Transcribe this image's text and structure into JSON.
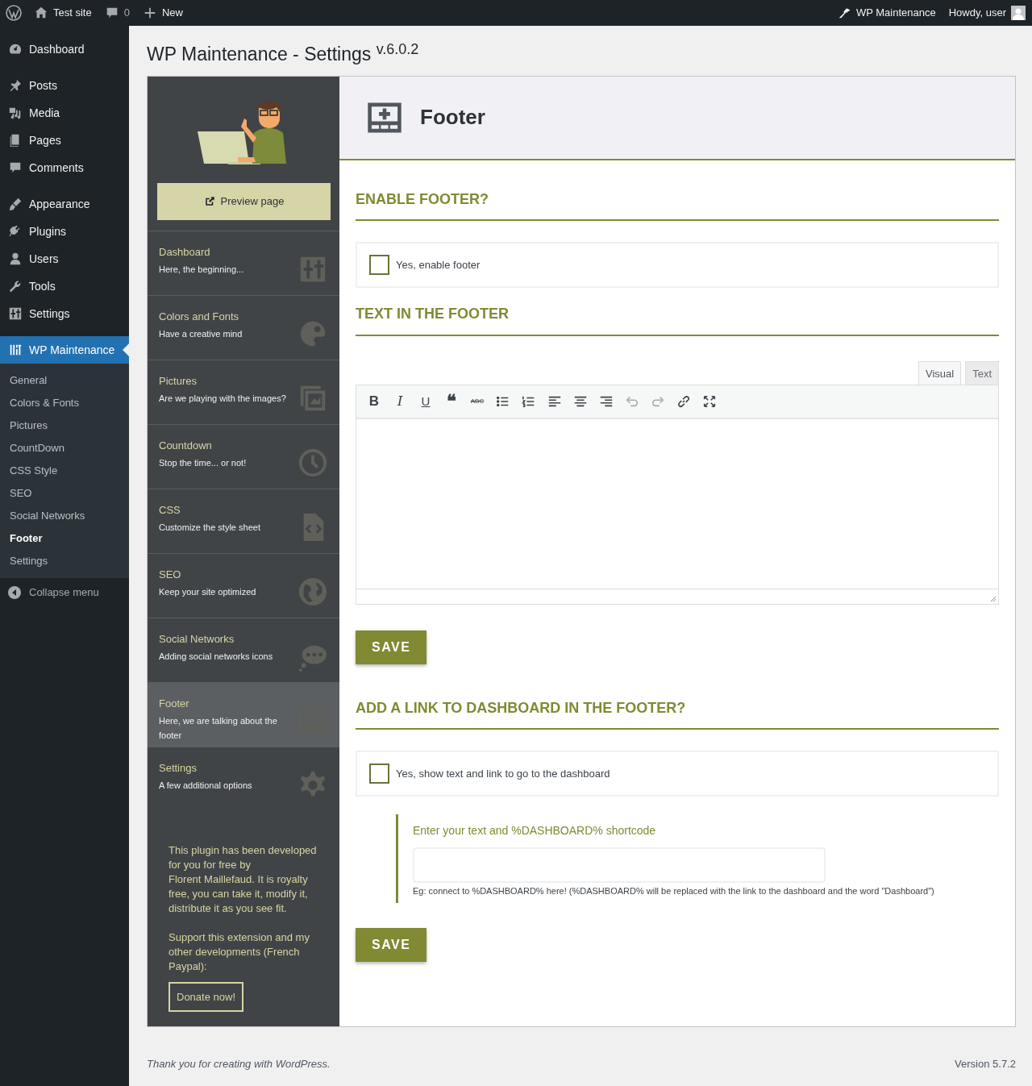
{
  "admin_bar": {
    "site": "Test site",
    "comments": "0",
    "new": "New",
    "plugin": "WP Maintenance",
    "greeting": "Howdy, user"
  },
  "admin_menu": {
    "groups": [
      [
        {
          "label": "Dashboard",
          "selected": false
        }
      ],
      [
        {
          "label": "Posts",
          "selected": false
        },
        {
          "label": "Media",
          "selected": false
        },
        {
          "label": "Pages",
          "selected": false
        },
        {
          "label": "Comments",
          "selected": false
        }
      ],
      [
        {
          "label": "Appearance",
          "selected": false
        },
        {
          "label": "Plugins",
          "selected": false
        },
        {
          "label": "Users",
          "selected": false
        },
        {
          "label": "Tools",
          "selected": false
        },
        {
          "label": "Settings",
          "selected": false
        }
      ],
      [
        {
          "label": "WP Maintenance",
          "selected": true
        }
      ]
    ],
    "submenu": [
      {
        "label": "General",
        "selected": false
      },
      {
        "label": "Colors & Fonts",
        "selected": false
      },
      {
        "label": "Pictures",
        "selected": false
      },
      {
        "label": "CountDown",
        "selected": false
      },
      {
        "label": "CSS Style",
        "selected": false
      },
      {
        "label": "SEO",
        "selected": false
      },
      {
        "label": "Social Networks",
        "selected": false
      },
      {
        "label": "Footer",
        "selected": true
      },
      {
        "label": "Settings",
        "selected": false
      }
    ],
    "collapse": "Collapse menu"
  },
  "page": {
    "title": "WP Maintenance - Settings",
    "version": "v.6.0.2"
  },
  "plugin_nav": {
    "preview": "Preview page",
    "items": [
      {
        "title": "Dashboard",
        "subtitle": "Here, the beginning...",
        "selected": false
      },
      {
        "title": "Colors and Fonts",
        "subtitle": "Have a creative mind",
        "selected": false
      },
      {
        "title": "Pictures",
        "subtitle": "Are we playing with the images?",
        "selected": false
      },
      {
        "title": "Countdown",
        "subtitle": "Stop the time... or not!",
        "selected": false
      },
      {
        "title": "CSS",
        "subtitle": "Customize the style sheet",
        "selected": false
      },
      {
        "title": "SEO",
        "subtitle": "Keep your site optimized",
        "selected": false
      },
      {
        "title": "Social Networks",
        "subtitle": "Adding social networks icons",
        "selected": false
      },
      {
        "title": "Footer",
        "subtitle": "Here, we are talking about the footer",
        "selected": true
      },
      {
        "title": "Settings",
        "subtitle": "A few additional options",
        "selected": false
      }
    ],
    "credit": {
      "before": "This plugin has been developed for you for free by",
      "link": "Florent Maillefaud",
      "after": ". It is royalty free, you can take it, modify it, distribute it as you see fit."
    },
    "support": "Support this extension and my other developments (French Paypal):",
    "donate": "Donate now!"
  },
  "panel": {
    "title": "Footer",
    "enable": {
      "heading": "ENABLE FOOTER?",
      "checkbox": {
        "label": "Yes, enable footer",
        "checked": false
      }
    },
    "text": {
      "heading": "TEXT IN THE FOOTER",
      "tabs": [
        {
          "label": "Visual",
          "selected": true
        },
        {
          "label": "Text",
          "selected": false
        }
      ],
      "toolbar": [
        {
          "kind": "bold",
          "glyph": "B"
        },
        {
          "kind": "italic",
          "glyph": "I"
        },
        {
          "kind": "underline",
          "glyph": "U"
        },
        {
          "kind": "quote",
          "glyph": "❝"
        },
        {
          "kind": "strike",
          "glyph": "ABC"
        },
        {
          "kind": "bullets"
        },
        {
          "kind": "numbers"
        },
        {
          "kind": "align-left"
        },
        {
          "kind": "align-center"
        },
        {
          "kind": "align-right"
        },
        {
          "kind": "undo"
        },
        {
          "kind": "redo"
        },
        {
          "kind": "link"
        },
        {
          "kind": "fullscreen"
        }
      ],
      "save": "SAVE"
    },
    "link": {
      "heading": "ADD A LINK TO DASHBOARD IN THE FOOTER?",
      "checkbox": {
        "label": "Yes, show text and link to go to the dashboard",
        "checked": false
      },
      "field_label": "Enter your text and %DASHBOARD% shortcode",
      "help": "Eg: connect to %DASHBOARD% here! (%DASHBOARD% will be replaced with the link to the dashboard and the word \"Dashboard\")",
      "save": "SAVE"
    }
  },
  "footer": {
    "before": "Thank you for creating with",
    "link": "WordPress",
    "after": ".",
    "version": "Version 5.7.2"
  }
}
